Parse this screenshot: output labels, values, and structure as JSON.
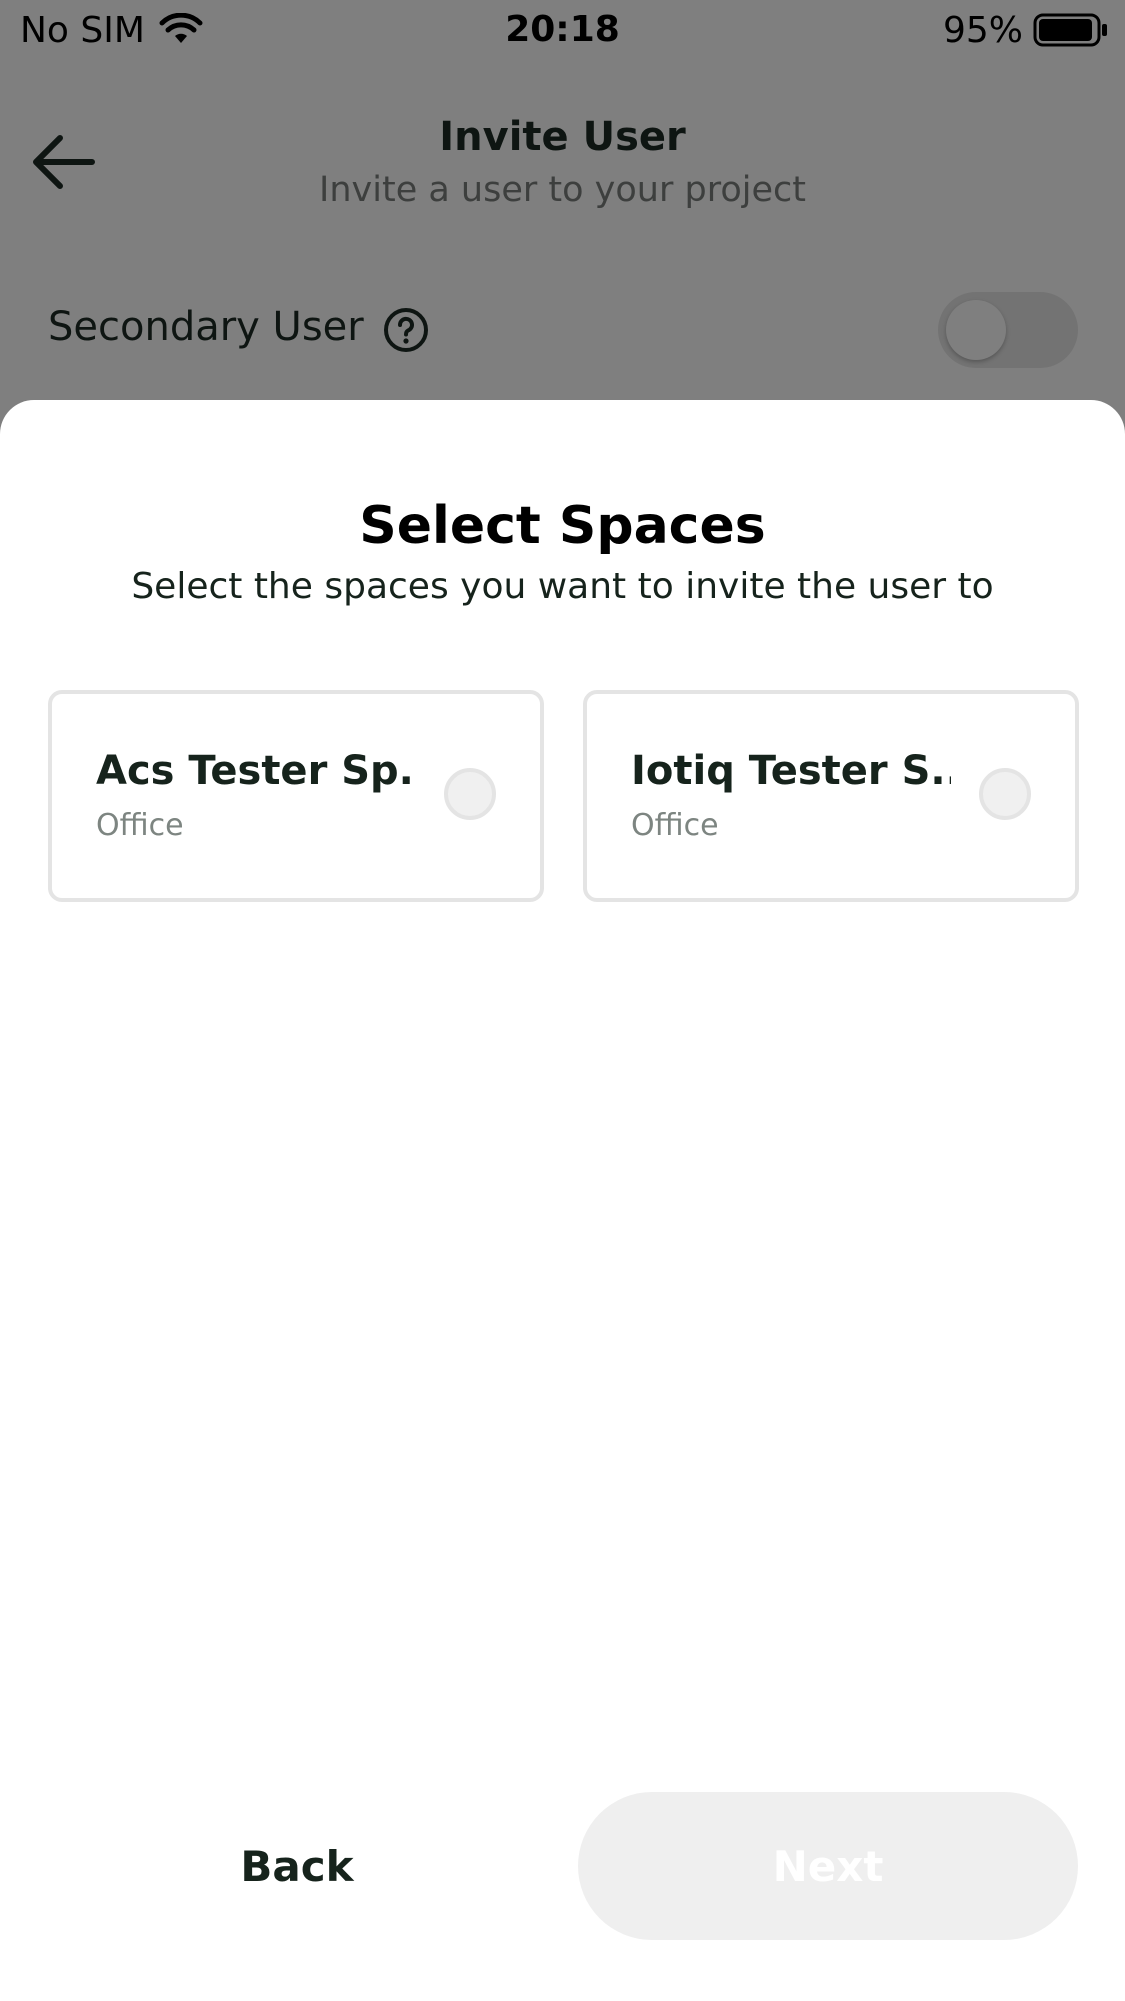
{
  "status_bar": {
    "carrier": "No SIM",
    "time": "20:18",
    "battery_percent": "95%",
    "battery_level": 0.95,
    "icons": [
      "wifi-icon",
      "battery-icon"
    ]
  },
  "header": {
    "title": "Invite User",
    "subtitle": "Invite a user to your project",
    "back_icon": "arrow-left-icon"
  },
  "secondary_user": {
    "label": "Secondary User",
    "help_icon": "question-circle-icon",
    "toggle_on": false
  },
  "sheet": {
    "title": "Select Spaces",
    "subtitle": "Select the spaces you want to invite the user to",
    "spaces": [
      {
        "name": "Acs Tester Sp...",
        "type": "Office",
        "selected": false
      },
      {
        "name": "Iotiq Tester S...",
        "type": "Office",
        "selected": false
      }
    ],
    "back_label": "Back",
    "next_label": "Next",
    "next_enabled": false
  },
  "colors": {
    "overlay": "#000000",
    "text_dark": "#16231c",
    "card_border": "#e4e4e4",
    "next_disabled_bg": "#efefef"
  }
}
